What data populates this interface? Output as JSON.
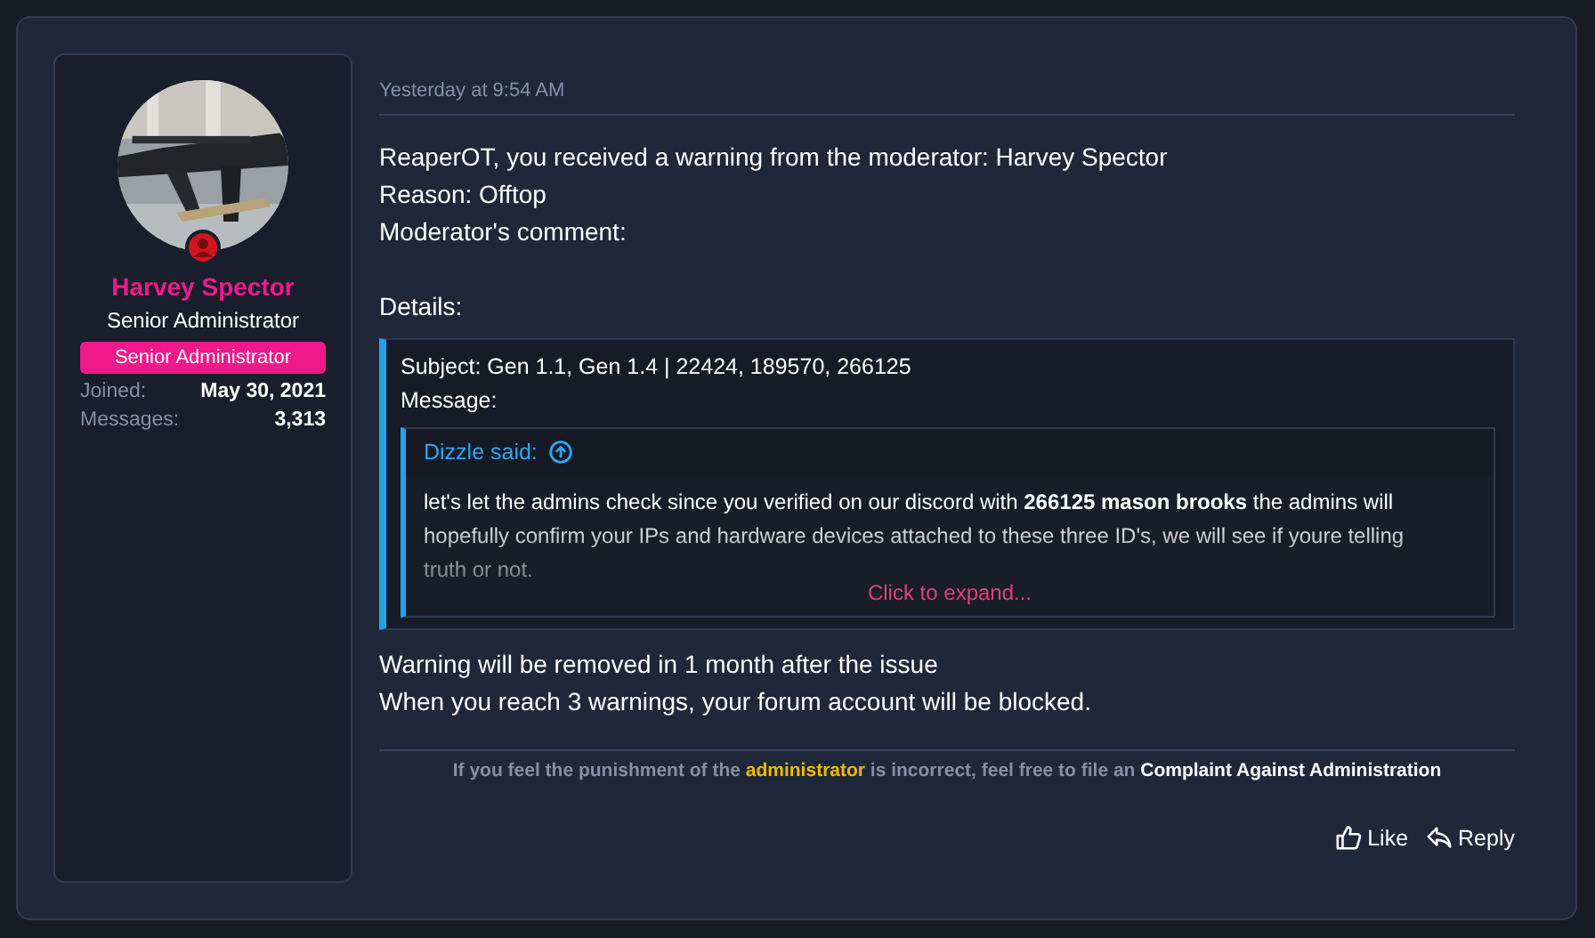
{
  "user": {
    "name": "Harvey Spector",
    "title": "Senior Administrator",
    "banner": "Senior Administrator",
    "stats": [
      {
        "label": "Joined:",
        "value": "May 30, 2021"
      },
      {
        "label": "Messages:",
        "value": "3,313"
      }
    ]
  },
  "post": {
    "time": "Yesterday at 9:54 AM",
    "lines": [
      "ReaperOT, you received a warning from the moderator: Harvey Spector",
      "Reason: Offtop",
      "Moderator's comment:"
    ],
    "details_label": "Details:",
    "details": {
      "lines": [
        "Subject: Gen 1.1, Gen 1.4 | 22424, 189570, 266125",
        "Message:"
      ],
      "quote": {
        "author": "Dizzle said:",
        "text": "let's let the admins check since you verified on our discord with **266125 mason brooks** the admins will hopefully confirm your IPs and hardware devices attached to these three ID's, we will see if youre telling truth or not.",
        "expand": "Click to expand..."
      }
    },
    "after_lines": [
      "Warning will be removed in 1 month after the issue",
      "When you reach 3 warnings, your forum account will be blocked."
    ],
    "notice": {
      "before": "If you feel the punishment of the",
      "highlight": "administrator",
      "middle": "is incorrect, feel free to file an",
      "link": "Complaint Against Administration"
    },
    "actions": [
      {
        "kind": "like",
        "label": "Like"
      },
      {
        "kind": "reply",
        "label": "Reply"
      }
    ]
  }
}
